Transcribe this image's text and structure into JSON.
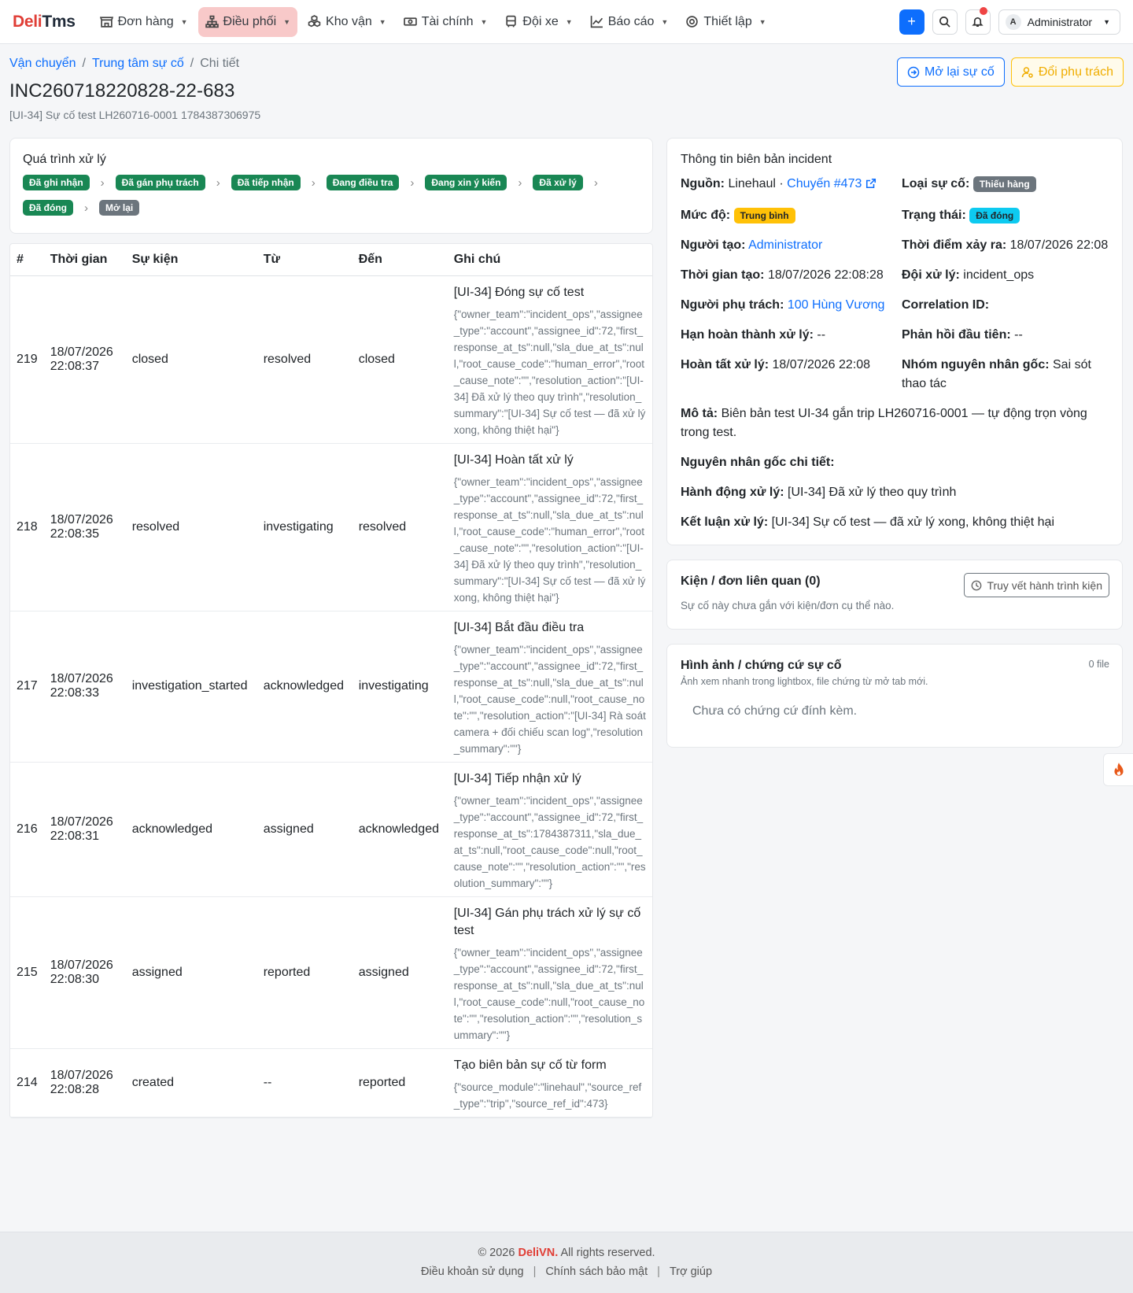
{
  "brand": {
    "part1": "Deli",
    "part2": "Tms"
  },
  "nav": {
    "items": [
      {
        "label": "Đơn hàng",
        "active": false
      },
      {
        "label": "Điều phối",
        "active": true
      },
      {
        "label": "Kho vận",
        "active": false
      },
      {
        "label": "Tài chính",
        "active": false
      },
      {
        "label": "Đội xe",
        "active": false
      },
      {
        "label": "Báo cáo",
        "active": false
      },
      {
        "label": "Thiết lập",
        "active": false
      }
    ],
    "plus_label": "+",
    "user_initial": "A",
    "user_name": "Administrator"
  },
  "breadcrumb": {
    "item1": "Vận chuyển",
    "item2": "Trung tâm sự cố",
    "item3": "Chi tiết",
    "sep": "/"
  },
  "page": {
    "title": "INC260718220828-22-683",
    "subtitle": "[UI-34] Sự cố test LH260716-0001 1784387306975",
    "reopen_label": "Mở lại sự cố",
    "reassign_label": "Đổi phụ trách"
  },
  "process": {
    "title": "Quá trình xử lý",
    "steps": [
      {
        "label": "Đã ghi nhận",
        "color": "#198754"
      },
      {
        "label": "Đã gán phụ trách",
        "color": "#198754"
      },
      {
        "label": "Đã tiếp nhận",
        "color": "#198754"
      },
      {
        "label": "Đang điều tra",
        "color": "#198754"
      },
      {
        "label": "Đang xin ý kiến",
        "color": "#198754"
      },
      {
        "label": "Đã xử lý",
        "color": "#198754"
      },
      {
        "label": "Đã đóng",
        "color": "#198754"
      },
      {
        "label": "Mở lại",
        "color": "#6c757d"
      }
    ]
  },
  "history": {
    "headers": {
      "id": "#",
      "time": "Thời gian",
      "event": "Sự kiện",
      "from": "Từ",
      "to": "Đến",
      "note": "Ghi chú"
    },
    "rows": [
      {
        "id": "219",
        "date": "18/07/2026",
        "time": "22:08:37",
        "event": "closed",
        "from": "resolved",
        "to": "closed",
        "note_title": "[UI-34] Đóng sự cố test",
        "note_json": "{\"owner_team\":\"incident_ops\",\"assignee_type\":\"account\",\"assignee_id\":72,\"first_response_at_ts\":null,\"sla_due_at_ts\":null,\"root_cause_code\":\"human_error\",\"root_cause_note\":\"\",\"resolution_action\":\"[UI-34] Đã xử lý theo quy trình\",\"resolution_summary\":\"[UI-34] Sự cố test — đã xử lý xong, không thiệt hại\"}"
      },
      {
        "id": "218",
        "date": "18/07/2026",
        "time": "22:08:35",
        "event": "resolved",
        "from": "investigating",
        "to": "resolved",
        "note_title": "[UI-34] Hoàn tất xử lý",
        "note_json": "{\"owner_team\":\"incident_ops\",\"assignee_type\":\"account\",\"assignee_id\":72,\"first_response_at_ts\":null,\"sla_due_at_ts\":null,\"root_cause_code\":\"human_error\",\"root_cause_note\":\"\",\"resolution_action\":\"[UI-34] Đã xử lý theo quy trình\",\"resolution_summary\":\"[UI-34] Sự cố test — đã xử lý xong, không thiệt hại\"}"
      },
      {
        "id": "217",
        "date": "18/07/2026",
        "time": "22:08:33",
        "event": "investigation_started",
        "from": "acknowledged",
        "to": "investigating",
        "note_title": "[UI-34] Bắt đầu điều tra",
        "note_json": "{\"owner_team\":\"incident_ops\",\"assignee_type\":\"account\",\"assignee_id\":72,\"first_response_at_ts\":null,\"sla_due_at_ts\":null,\"root_cause_code\":null,\"root_cause_note\":\"\",\"resolution_action\":\"[UI-34] Rà soát camera + đối chiếu scan log\",\"resolution_summary\":\"\"}"
      },
      {
        "id": "216",
        "date": "18/07/2026",
        "time": "22:08:31",
        "event": "acknowledged",
        "from": "assigned",
        "to": "acknowledged",
        "note_title": "[UI-34] Tiếp nhận xử lý",
        "note_json": "{\"owner_team\":\"incident_ops\",\"assignee_type\":\"account\",\"assignee_id\":72,\"first_response_at_ts\":1784387311,\"sla_due_at_ts\":null,\"root_cause_code\":null,\"root_cause_note\":\"\",\"resolution_action\":\"\",\"resolution_summary\":\"\"}"
      },
      {
        "id": "215",
        "date": "18/07/2026",
        "time": "22:08:30",
        "event": "assigned",
        "from": "reported",
        "to": "assigned",
        "note_title": "[UI-34] Gán phụ trách xử lý sự cố test",
        "note_json": "{\"owner_team\":\"incident_ops\",\"assignee_type\":\"account\",\"assignee_id\":72,\"first_response_at_ts\":null,\"sla_due_at_ts\":null,\"root_cause_code\":null,\"root_cause_note\":\"\",\"resolution_action\":\"\",\"resolution_summary\":\"\"}"
      },
      {
        "id": "214",
        "date": "18/07/2026",
        "time": "22:08:28",
        "event": "created",
        "from": "--",
        "to": "reported",
        "note_title": "Tạo biên bản sự cố từ form",
        "note_json": "{\"source_module\":\"linehaul\",\"source_ref_type\":\"trip\",\"source_ref_id\":473}"
      }
    ]
  },
  "info": {
    "title": "Thông tin biên bản incident",
    "source_label": "Nguồn:",
    "source_value": "Linehaul ·",
    "source_link": "Chuyến #473",
    "type_label": "Loại sự cố:",
    "type_value": "Thiếu hàng",
    "level_label": "Mức độ:",
    "level_value": "Trung bình",
    "status_label": "Trạng thái:",
    "status_value": "Đã đóng",
    "creator_label": "Người tạo:",
    "creator_value": "Administrator",
    "occurred_label": "Thời điểm xảy ra:",
    "occurred_value": "18/07/2026 22:08",
    "created_label": "Thời gian tạo:",
    "created_value": "18/07/2026 22:08:28",
    "team_label": "Đội xử lý:",
    "team_value": "incident_ops",
    "owner_label": "Người phụ trách:",
    "owner_value": "100 Hùng Vương",
    "corr_label": "Correlation ID:",
    "corr_value": "",
    "deadline_label": "Hạn hoàn thành xử lý:",
    "deadline_value": "--",
    "firstresp_label": "Phản hồi đầu tiên:",
    "firstresp_value": "--",
    "done_label": "Hoàn tất xử lý:",
    "done_value": "18/07/2026 22:08",
    "rootgroup_label": "Nhóm nguyên nhân gốc:",
    "rootgroup_value": "Sai sót thao tác",
    "desc_label": "Mô tả:",
    "desc_value": "Biên bản test UI-34 gắn trip LH260716-0001 — tự động trọn vòng trong test.",
    "rootdetail_label": "Nguyên nhân gốc chi tiết:",
    "rootdetail_value": "",
    "action_label": "Hành động xử lý:",
    "action_value": "[UI-34] Đã xử lý theo quy trình",
    "conclusion_label": "Kết luận xử lý:",
    "conclusion_value": "[UI-34] Sự cố test — đã xử lý xong, không thiệt hại"
  },
  "related": {
    "title": "Kiện / đơn liên quan (0)",
    "trace_label": "Truy vết hành trình kiện",
    "empty_text": "Sự cố này chưa gắn với kiện/đơn cụ thể nào."
  },
  "evidence": {
    "title": "Hình ảnh / chứng cứ sự cố",
    "subtitle": "Ảnh xem nhanh trong lightbox, file chứng từ mở tab mới.",
    "count": "0 file",
    "empty_text": "Chưa có chứng cứ đính kèm."
  },
  "footer": {
    "copyright_prefix": "© 2026",
    "brand": "DeliVN.",
    "copyright_suffix": "All rights reserved.",
    "link1": "Điều khoản sử dụng",
    "link2": "Chính sách bảo mật",
    "link3": "Trợ giúp",
    "sep": "|"
  }
}
